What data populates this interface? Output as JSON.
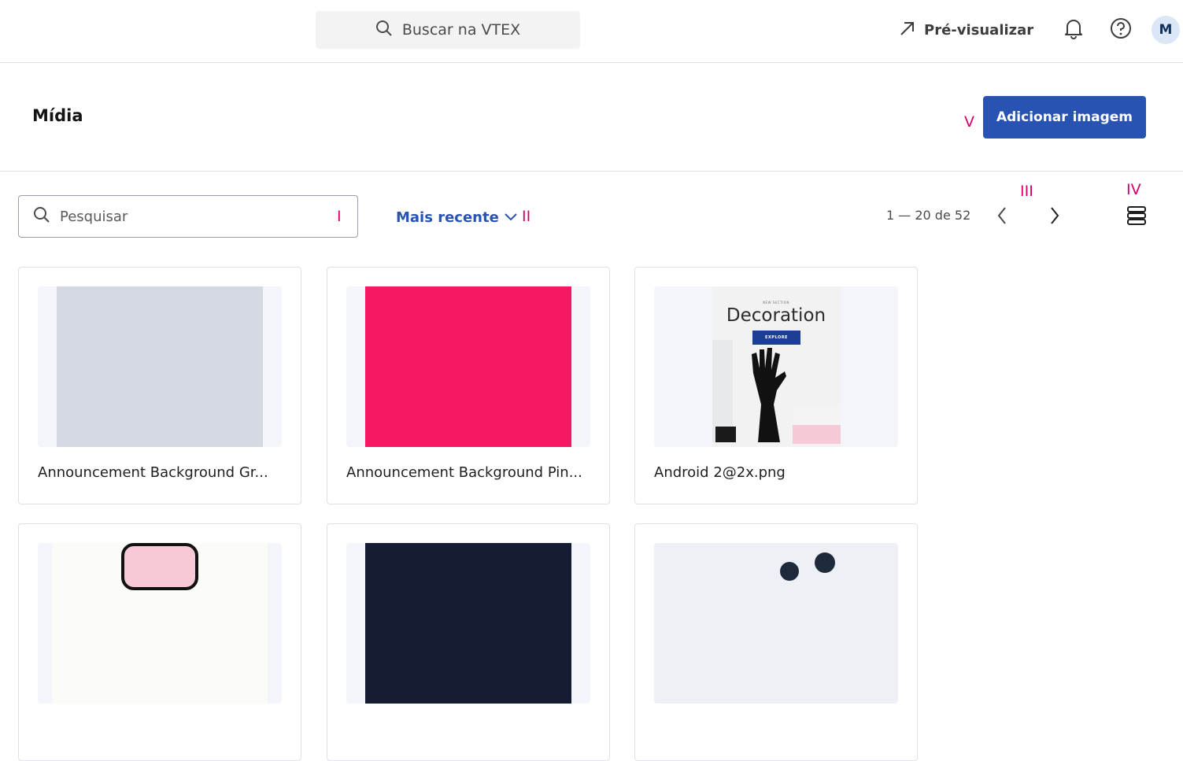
{
  "topbar": {
    "search_placeholder": "Buscar na VTEX",
    "preview_label": "Pré-visualizar",
    "avatar_initial": "M"
  },
  "page": {
    "title": "Mídia",
    "add_button_label": "Adicionar imagem"
  },
  "toolbar": {
    "search_placeholder": "Pesquisar",
    "sort_label": "Mais recente",
    "pagination_label": "1 — 20 de 52"
  },
  "annotations": {
    "search": "I",
    "sort": "II",
    "pagination": "III",
    "view_toggle": "IV",
    "add_button": "V"
  },
  "media_items": [
    {
      "name": "Announcement Background Gr...",
      "thumb_color": "#d5d9e1"
    },
    {
      "name": "Announcement Background Pin...",
      "thumb_color": "#f51964"
    },
    {
      "name": "Android 2@2x.png",
      "thumb_kicker": "NEW SECTION",
      "thumb_title": "Decoration",
      "thumb_button": "EXPLORE"
    },
    {
      "name": "",
      "thumb_color": "#f7d0dc"
    },
    {
      "name": "",
      "thumb_color": "#141d33"
    },
    {
      "name": "",
      "thumb_color": "#eef0f6"
    }
  ],
  "colors": {
    "primary": "#2953b2",
    "annotation": "#d3006b"
  }
}
